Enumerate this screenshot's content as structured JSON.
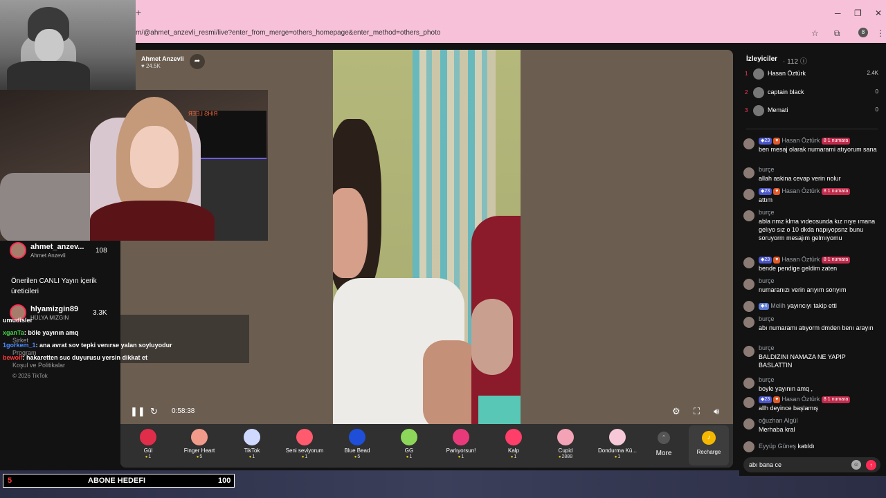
{
  "browser": {
    "url": "m/@ahmet_anzevli_resmi/live?enter_from_merge=others_homepage&enter_method=others_photo",
    "new_tab": "+",
    "minimize": "─",
    "restore": "❐",
    "close": "✕",
    "profile_initial": "8"
  },
  "host": {
    "name": "Ahmet Anzevli",
    "likes": "24.5K"
  },
  "player": {
    "time": "0:58:38"
  },
  "gifts": [
    {
      "name": "Gül",
      "price": "1",
      "color": "#e02d4a"
    },
    {
      "name": "Finger Heart",
      "price": "5",
      "color": "#f29b8b"
    },
    {
      "name": "TikTok",
      "price": "1",
      "color": "#cfd8ff"
    },
    {
      "name": "Seni seviyorum",
      "price": "1",
      "color": "#ff5a6e"
    },
    {
      "name": "Blue Bead",
      "price": "5",
      "color": "#1f4fd8"
    },
    {
      "name": "GG",
      "price": "1",
      "color": "#8cd65a"
    },
    {
      "name": "Parlıyorsun!",
      "price": "1",
      "color": "#e83a7a"
    },
    {
      "name": "Kalp",
      "price": "1",
      "color": "#ff3f6a"
    },
    {
      "name": "Cupid",
      "price": "2888",
      "color": "#f4a3b6"
    },
    {
      "name": "Dondurma Kü...",
      "price": "1",
      "color": "#f7c8d8"
    }
  ],
  "more_label": "More",
  "recharge_label": "Recharge",
  "sidebar": {
    "live1_name": "ahmet_anzev...",
    "live1_sub": "Ahmet Anzevli",
    "live1_count": "108",
    "suggest1": "Önerilen CANLI Yayın içerik",
    "suggest2": "üreticileri",
    "live2_name": "hlyamizgin89",
    "live2_sub": "HÜLYA MIZGIN",
    "live2_count": "3.3K",
    "dim1": "Şirket",
    "dim2": "Program",
    "dim3": "Koşul ve Politikalar",
    "copyright": "© 2026 TikTok"
  },
  "overlay_chat": [
    {
      "user": "umudisler",
      "text": "",
      "color": "#ffffff"
    },
    {
      "user": "xganTa",
      "text": ": böle yayının amq",
      "color": "#47d147"
    },
    {
      "user": "1gorkem_1",
      "text": ": ana avrat sov tepki venırse yalan soyluyodur",
      "color": "#4e8cff"
    },
    {
      "user": "bewolf",
      "text": ": hakaretten suc duyurusu yersin dikkat et",
      "color": "#ff3b3b"
    }
  ],
  "abone": {
    "count": "5",
    "title": "ABONE HEDEFI",
    "goal": "100"
  },
  "viewers": {
    "title": "İzleyiciler",
    "count": "· 112",
    "list": [
      {
        "rank": "1",
        "name": "Hasan Öztürk",
        "score": "2.4K"
      },
      {
        "rank": "2",
        "name": "captain black",
        "score": "0"
      },
      {
        "rank": "3",
        "name": "Memati",
        "score": "0"
      }
    ]
  },
  "chat": [
    {
      "user": "Hasan Öztürk",
      "lvl": "23",
      "tag": "1 numara",
      "text": "ben mesaj olarak numarami atıyorum sana"
    },
    {
      "user": "burçe",
      "text": "allah askina cevap verin nolur"
    },
    {
      "user": "Hasan Öztürk",
      "lvl": "23",
      "tag": "1 numara",
      "text": "attım"
    },
    {
      "user": "burçe",
      "text": "abla nmz klma vıdeosunda kız nıye ımana gelıyo sız o 10 dkda napıyopsnz bunu soruyorm mesajım gelmıyomu"
    },
    {
      "user": "Hasan Öztürk",
      "lvl": "23",
      "tag": "1 numara",
      "text": "bende pendige geldim zaten"
    },
    {
      "user": "burçe",
      "text": "numaranızı verin arıyım sorıyım"
    },
    {
      "user": "Melih",
      "lvl": "4",
      "text": "yayıncıyı takip etti",
      "inline": true
    },
    {
      "user": "burçe",
      "text": "abı numaramı atıyorm dmden benı arayın"
    },
    {
      "user": "burçe",
      "text": "BALDIZINI NAMAZA NE YAPIP BASLATTIN"
    },
    {
      "user": "burçe",
      "text": "boyle yayının amq ,"
    },
    {
      "user": "Hasan Öztürk",
      "lvl": "23",
      "tag": "1 numara",
      "text": "allh deyince başlamış"
    },
    {
      "user": "oğuzhan Algül",
      "text": "Merhaba kral"
    },
    {
      "user": "Eyyüp Güneş",
      "text": "katıldı",
      "inline": true
    }
  ],
  "input": {
    "value": "abı bana ce"
  }
}
